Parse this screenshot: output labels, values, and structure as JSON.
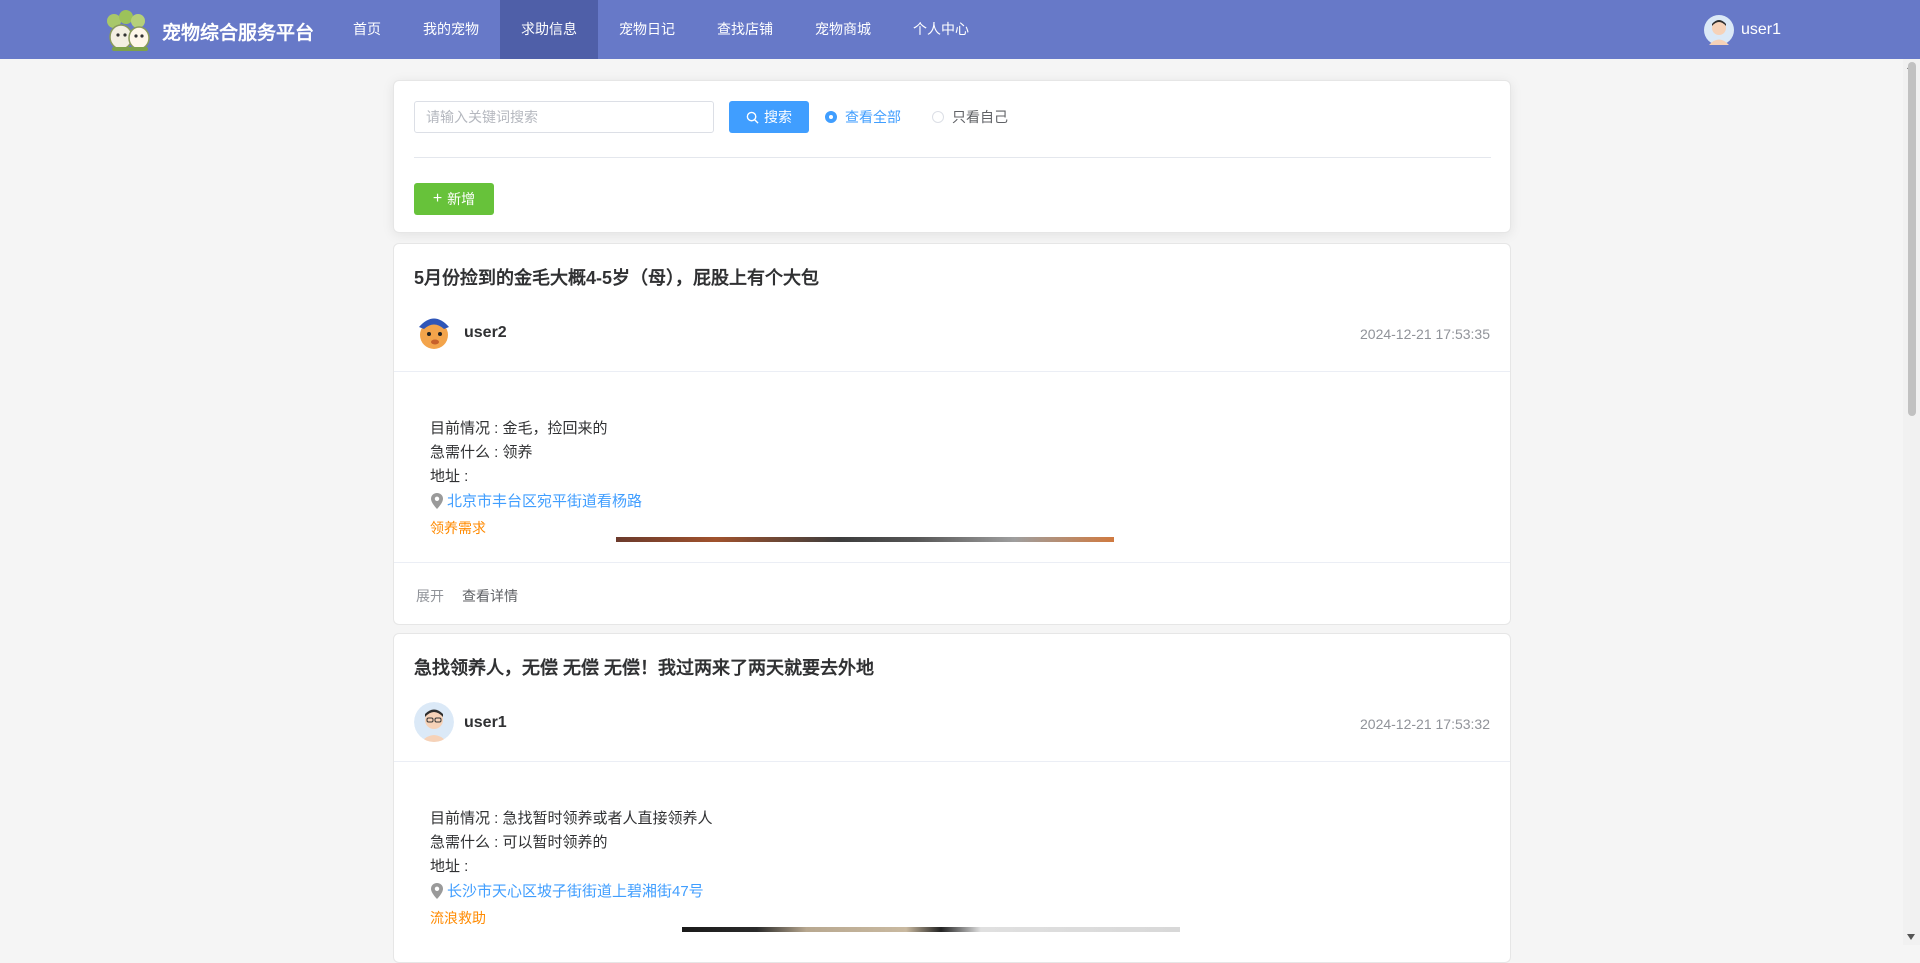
{
  "header": {
    "title": "宠物综合服务平台",
    "nav": [
      "首页",
      "我的宠物",
      "求助信息",
      "宠物日记",
      "查找店铺",
      "宠物商城",
      "个人中心"
    ],
    "active_index": 2,
    "username": "user1"
  },
  "search": {
    "placeholder": "请输入关键词搜索",
    "button_label": "搜索",
    "radio_all": "查看全部",
    "radio_mine": "只看自己",
    "selected": "all",
    "add_label": "新增"
  },
  "posts": [
    {
      "title": "5月份捡到的金毛大概4-5岁（母），屁股上有个大包",
      "user": "user2",
      "time": "2024-12-21 17:53:35",
      "situation": "目前情况 : 金毛，捡回来的",
      "need": "急需什么 : 领养",
      "address_label": "地址 :",
      "address": "北京市丰台区宛平街道看杨路",
      "tag": "领养需求",
      "expand_label": "展开",
      "detail_label": "查看详情"
    },
    {
      "title": "急找领养人，无偿 无偿 无偿！我过两来了两天就要去外地",
      "user": "user1",
      "time": "2024-12-21 17:53:32",
      "situation": "目前情况 : 急找暂时领养或者人直接领养人",
      "need": "急需什么 : 可以暂时领养的",
      "address_label": "地址 :",
      "address": "长沙市天心区坡子街街道上碧湘街47号",
      "tag": "流浪救助"
    }
  ],
  "colors": {
    "header_bg": "#6779c8",
    "nav_active": "#4f5fa8",
    "primary": "#409eff",
    "success": "#67c23a",
    "tag_orange": "#ff8a00"
  }
}
